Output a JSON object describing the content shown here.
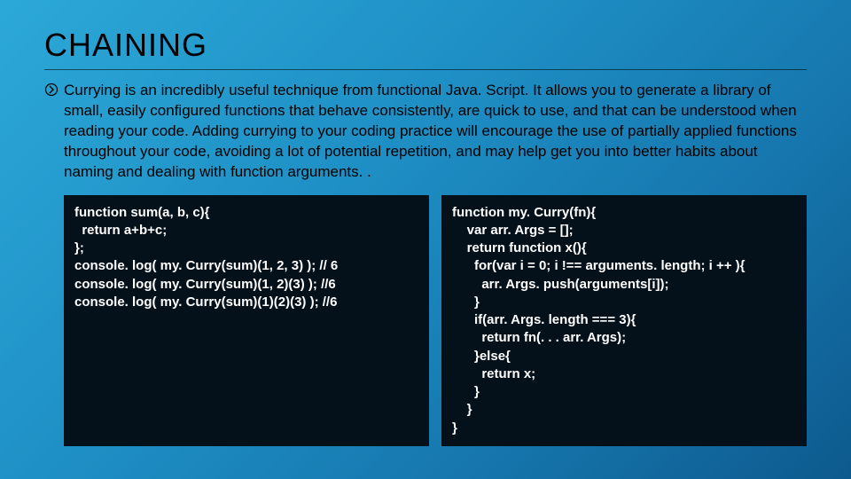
{
  "title": "CHAINING",
  "paragraph": "Currying is an incredibly useful technique from functional Java. Script. It allows you to generate a library of small, easily configured functions that behave consistently, are quick to use, and that can be understood when reading your code. Adding currying to your coding practice will encourage the use of partially applied functions throughout your code, avoiding a lot of potential repetition, and may help get you into better habits about naming and dealing with function arguments. .",
  "code_left": "function sum(a, b, c){\n  return a+b+c;\n};\nconsole. log( my. Curry(sum)(1, 2, 3) ); // 6\nconsole. log( my. Curry(sum)(1, 2)(3) ); //6\nconsole. log( my. Curry(sum)(1)(2)(3) ); //6",
  "code_right": "function my. Curry(fn){\n    var arr. Args = [];\n    return function x(){\n      for(var i = 0; i !== arguments. length; i ++ ){\n        arr. Args. push(arguments[i]);\n      }\n      if(arr. Args. length === 3){\n        return fn(. . . arr. Args);\n      }else{\n        return x;\n      }\n    }\n}"
}
